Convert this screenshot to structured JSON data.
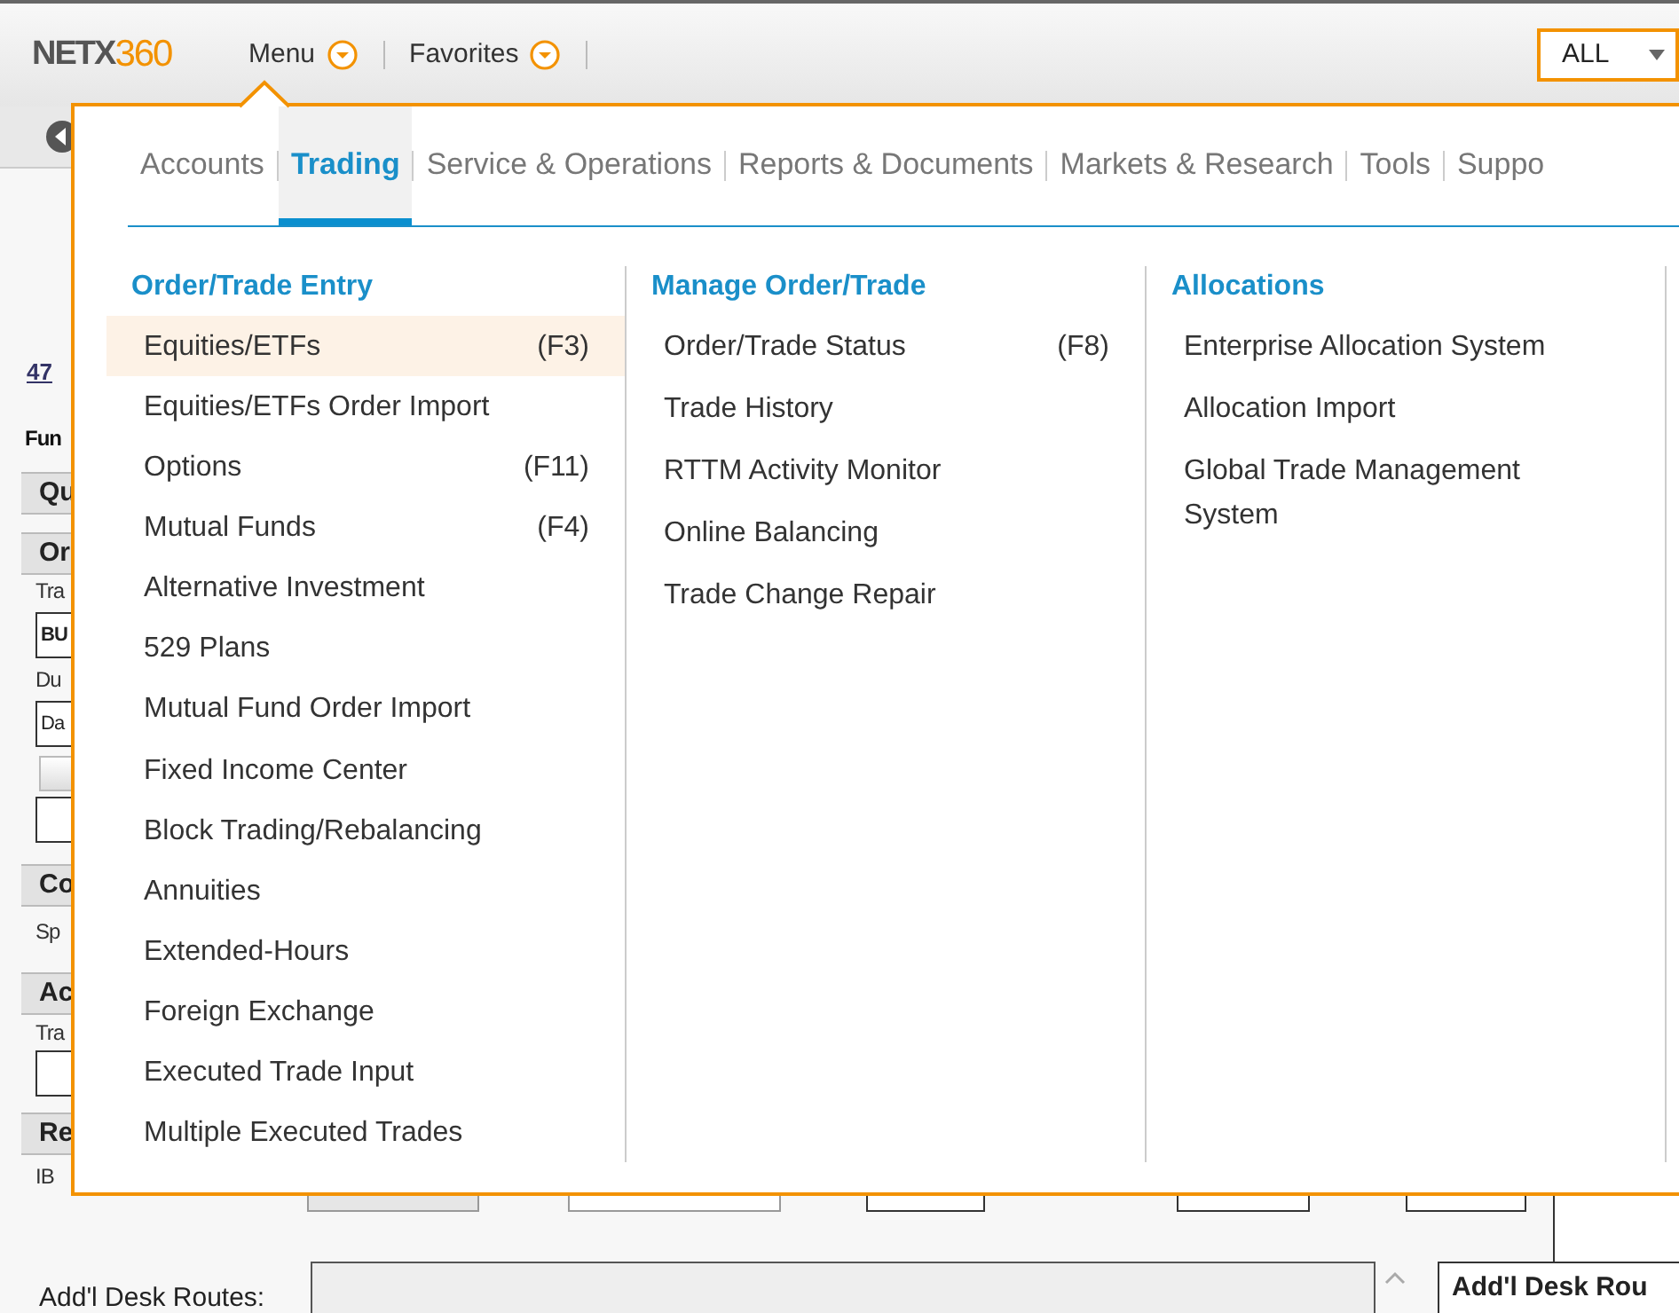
{
  "header": {
    "logo_prefix": "NETX",
    "logo_suffix": "360",
    "nav": [
      {
        "label": "Menu",
        "open": true
      },
      {
        "label": "Favorites",
        "open": false
      }
    ],
    "scope_select": "ALL"
  },
  "background_page": {
    "rows": [
      {
        "kind": "link",
        "text": "47"
      },
      {
        "kind": "label",
        "text": "Fun",
        "bold": true
      },
      {
        "kind": "section",
        "text": "Qu"
      },
      {
        "kind": "section",
        "text": "Or"
      },
      {
        "kind": "label",
        "text": "Tra",
        "bold": false
      },
      {
        "kind": "field",
        "text": "BU",
        "bold": true
      },
      {
        "kind": "label",
        "text": "Du",
        "bold": false
      },
      {
        "kind": "field",
        "text": "Da",
        "bold": false
      },
      {
        "kind": "button"
      },
      {
        "kind": "field"
      },
      {
        "kind": "section",
        "text": "Co"
      },
      {
        "kind": "label",
        "text": "Sp",
        "bold": false
      },
      {
        "kind": "section",
        "text": "Ac"
      },
      {
        "kind": "label",
        "text": "Tra",
        "bold": false
      },
      {
        "kind": "field"
      },
      {
        "kind": "section",
        "text": "Re"
      },
      {
        "kind": "label",
        "text": "IB",
        "bold": false
      }
    ],
    "desk_routes_label": "Add'l Desk Routes:",
    "desk_routes_button": "Add'l Desk Rou"
  },
  "menu": {
    "tabs": [
      {
        "label": "Accounts",
        "selected": false
      },
      {
        "label": "Trading",
        "selected": true
      },
      {
        "label": "Service & Operations",
        "selected": false
      },
      {
        "label": "Reports & Documents",
        "selected": false
      },
      {
        "label": "Markets & Research",
        "selected": false
      },
      {
        "label": "Tools",
        "selected": false
      },
      {
        "label": "Suppo",
        "selected": false
      }
    ],
    "columns": [
      {
        "title": "Order/Trade Entry",
        "items": [
          {
            "label": "Equities/ETFs",
            "shortcut": "(F3)",
            "hovered": true
          },
          {
            "label": "Equities/ETFs Order Import",
            "hovered": false
          },
          {
            "label": "Options",
            "shortcut": "(F11)",
            "hovered": false
          },
          {
            "label": "Mutual Funds",
            "shortcut": "(F4)",
            "hovered": false
          },
          {
            "label": "Alternative Investment",
            "hovered": false
          },
          {
            "label": "529 Plans",
            "hovered": false
          },
          {
            "label": "Mutual Fund Order Import",
            "hovered": false
          },
          {
            "label": "Fixed Income Center",
            "hovered": false
          },
          {
            "label": "Block Trading/Rebalancing",
            "hovered": false
          },
          {
            "label": "Annuities",
            "hovered": false
          },
          {
            "label": "Extended-Hours",
            "hovered": false
          },
          {
            "label": "Foreign Exchange",
            "hovered": false
          },
          {
            "label": "Executed Trade Input",
            "hovered": false
          },
          {
            "label": "Multiple Executed Trades",
            "hovered": false
          }
        ]
      },
      {
        "title": "Manage Order/Trade",
        "items": [
          {
            "label": "Order/Trade Status",
            "shortcut": "(F8)",
            "hovered": false
          },
          {
            "label": "Trade History",
            "hovered": false
          },
          {
            "label": "RTTM Activity Monitor",
            "hovered": false
          },
          {
            "label": "Online Balancing",
            "hovered": false
          },
          {
            "label": "Trade Change Repair",
            "hovered": false
          }
        ]
      },
      {
        "title": "Allocations",
        "items": [
          {
            "label": "Enterprise Allocation System",
            "hovered": false
          },
          {
            "label": "Allocation Import",
            "hovered": false
          },
          {
            "label": "Global Trade Management System",
            "hovered": false
          }
        ]
      }
    ]
  }
}
